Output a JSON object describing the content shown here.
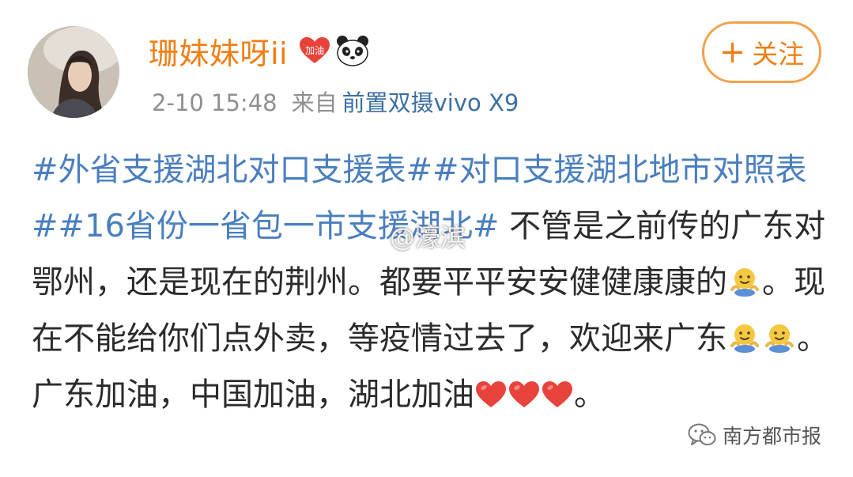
{
  "post": {
    "username": "珊妹妹呀ii",
    "badge_text": "加油",
    "timestamp": "2-10 15:48",
    "from_label": "来自",
    "device": "前置双摄vivo X9",
    "follow_button": "关注",
    "follow_plus": "+",
    "content": {
      "hashtag_1": "#外省支援湖北对口支援表#",
      "hashtag_2": "#对口支援湖北地市对照表#",
      "hashtag_3": "#16省份一省包一市支援湖北#",
      "text_1": " 不管是之前传的广东对鄂州，还是现在的荆州。都要平平安安健健康康的",
      "text_2": "。现在不能给你们点外卖，等疫情过去了，欢迎来广东",
      "text_3": "。广东加油，中国加油，湖北加油",
      "text_4": "。"
    },
    "emoji": {
      "face": "smiling-face-emoji",
      "heart": "red-heart-emoji"
    }
  },
  "watermarks": {
    "center": "@濠滨",
    "wechat": "南方都市报"
  },
  "colors": {
    "username": "#f07f15",
    "hashtag": "#4a7fbf",
    "device": "#3a6fa3",
    "meta": "#8f8f8f",
    "follow_border": "#f3a24a"
  }
}
